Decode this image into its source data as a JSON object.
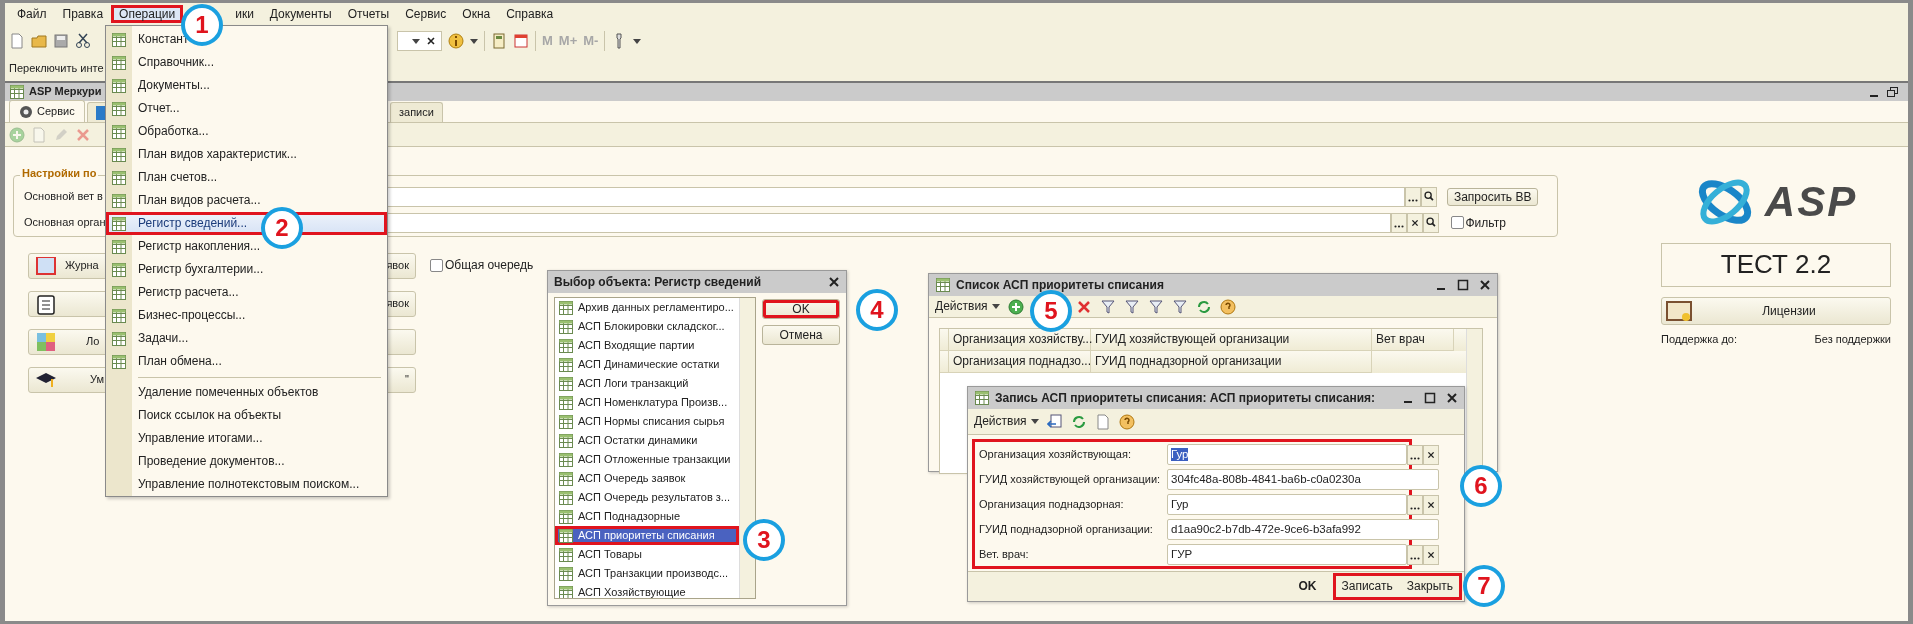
{
  "menu_bar": [
    {
      "label": "Файл",
      "selected": false
    },
    {
      "label": "Правка",
      "selected": false
    },
    {
      "label": "Операции",
      "selected": true
    },
    {
      "label": "ики",
      "selected": false
    },
    {
      "label": "Документы",
      "selected": false
    },
    {
      "label": "Отчеты",
      "selected": false
    },
    {
      "label": "Сервис",
      "selected": false
    },
    {
      "label": "Окна",
      "selected": false
    },
    {
      "label": "Справка",
      "selected": false
    }
  ],
  "memory_buttons": [
    "M",
    "M+",
    "M-"
  ],
  "switch_interface_label": "Переключить инте",
  "main_window": {
    "title": "ASP Меркури",
    "tabs": [
      {
        "label": "Сервис",
        "selected": true
      },
      {
        "selected": false
      },
      {
        "label": "записи",
        "selected": false
      }
    ],
    "settings_group": {
      "title": "Настройки по",
      "fields": [
        {
          "label": "Основной вет в",
          "kind": "request",
          "button": "Запросить ВВ"
        },
        {
          "label": "Основная орган",
          "kind": "filter",
          "checkbox": {
            "label": "Фильтр",
            "checked": false
          }
        }
      ]
    },
    "action_buttons": [
      {
        "left": "Журна",
        "right": "явок"
      },
      {
        "right": "явок"
      },
      {
        "left": "Ло"
      },
      {
        "left": "Ум",
        "right": "\""
      }
    ],
    "common_queue": {
      "label": "Общая очередь",
      "checked": false
    },
    "logo_text": "ASP",
    "edition": "ТЕСТ 2.2",
    "licenses_button": "Лицензии",
    "support_label": "Поддержка до:",
    "support_value": "Без поддержки"
  },
  "operations_menu": [
    {
      "label": "Констант",
      "kind": "object",
      "selected": false
    },
    {
      "label": "Справочник...",
      "kind": "object",
      "selected": false
    },
    {
      "label": "Документы...",
      "kind": "object",
      "selected": false
    },
    {
      "label": "Отчет...",
      "kind": "object",
      "selected": false
    },
    {
      "label": "Обработка...",
      "kind": "object",
      "selected": false
    },
    {
      "label": "План видов характеристик...",
      "kind": "object",
      "selected": false
    },
    {
      "label": "План счетов...",
      "kind": "object",
      "selected": false
    },
    {
      "label": "План видов расчета...",
      "kind": "object",
      "selected": false
    },
    {
      "label": "Регистр сведений...",
      "kind": "object",
      "selected": true
    },
    {
      "label": "Регистр накопления...",
      "kind": "object",
      "selected": false
    },
    {
      "label": "Регистр бухгалтерии...",
      "kind": "object",
      "selected": false
    },
    {
      "label": "Регистр расчета...",
      "kind": "object",
      "selected": false
    },
    {
      "label": "Бизнес-процессы...",
      "kind": "object",
      "selected": false
    },
    {
      "label": "Задачи...",
      "kind": "object",
      "selected": false
    },
    {
      "label": "План обмена...",
      "kind": "object",
      "selected": false
    },
    {
      "kind": "separator"
    },
    {
      "label": "Удаление помеченных объектов",
      "kind": "command",
      "selected": false
    },
    {
      "label": "Поиск ссылок на объекты",
      "kind": "command",
      "selected": false
    },
    {
      "label": "Управление итогами...",
      "kind": "command",
      "selected": false
    },
    {
      "label": "Проведение документов...",
      "kind": "command",
      "selected": false
    },
    {
      "label": "Управление полнотекстовым поиском...",
      "kind": "command",
      "selected": false
    }
  ],
  "select_dialog": {
    "title": "Выбор объекта: Регистр сведений",
    "items": [
      {
        "label": "Архив данных регламентиро...",
        "selected": false
      },
      {
        "label": "АСП Блокировки складског...",
        "selected": false
      },
      {
        "label": "АСП Входящие партии",
        "selected": false
      },
      {
        "label": "АСП Динамические остатки",
        "selected": false
      },
      {
        "label": "АСП Логи транзакций",
        "selected": false
      },
      {
        "label": "АСП Номенклатура Произв...",
        "selected": false
      },
      {
        "label": "АСП Нормы списания сырья",
        "selected": false
      },
      {
        "label": "АСП Остатки динамики",
        "selected": false
      },
      {
        "label": "АСП Отложенные транзакции",
        "selected": false
      },
      {
        "label": "АСП Очередь заявок",
        "selected": false
      },
      {
        "label": "АСП Очередь результатов з...",
        "selected": false
      },
      {
        "label": "АСП Поднадзорные",
        "selected": false
      },
      {
        "label": "АСП приоритеты списания",
        "selected": true
      },
      {
        "label": "АСП Товары",
        "selected": false
      },
      {
        "label": "АСП Транзакции производс...",
        "selected": false
      },
      {
        "label": "АСП Хозяйствующие",
        "selected": false
      }
    ],
    "ok": "OK",
    "cancel": "Отмена"
  },
  "list_window": {
    "title": "Список АСП приоритеты списания",
    "actions": "Действия",
    "header_row_1": [
      "Организация хозяйству...",
      "ГУИД хозяйствующей организации",
      "Вет врач"
    ],
    "header_row_2": [
      "Организация поднадзо...",
      "ГУИД поднадзорной организации"
    ]
  },
  "record_window": {
    "title": "Запись АСП приоритеты списания: АСП приоритеты списания:",
    "actions": "Действия",
    "fields": [
      {
        "label": "Организация хозяйствующая:",
        "value": "Гур",
        "kind": "reference",
        "selected": true
      },
      {
        "label": "ГУИД хозяйствующей организации:",
        "value": "304fc48a-808b-4841-ba6b-c0a0230a",
        "kind": "text",
        "selected": false
      },
      {
        "label": "Организация поднадзорная:",
        "value": "Гур",
        "kind": "reference",
        "selected": false
      },
      {
        "label": "ГУИД поднадзорной организации:",
        "value": "d1aa90c2-b7db-472e-9ce6-b3afa992",
        "kind": "text",
        "selected": false
      },
      {
        "label": "Вет. врач:",
        "value": "ГУР",
        "kind": "reference",
        "selected": false
      }
    ],
    "ok": "OK",
    "save": "Записать",
    "close": "Закрыть"
  },
  "step_markers": [
    "1",
    "2",
    "3",
    "4",
    "5",
    "6",
    "7"
  ]
}
